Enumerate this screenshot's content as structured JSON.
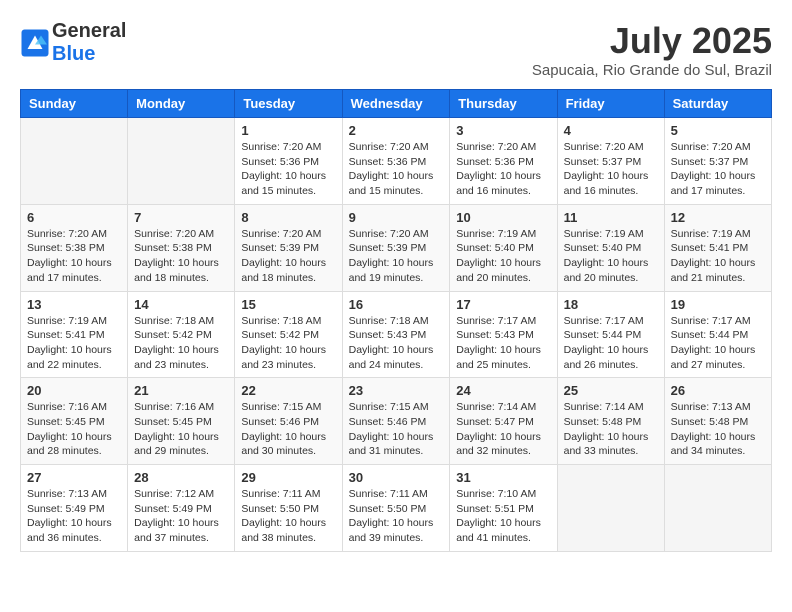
{
  "header": {
    "logo_line1": "General",
    "logo_line2": "Blue",
    "month": "July 2025",
    "location": "Sapucaia, Rio Grande do Sul, Brazil"
  },
  "days_of_week": [
    "Sunday",
    "Monday",
    "Tuesday",
    "Wednesday",
    "Thursday",
    "Friday",
    "Saturday"
  ],
  "weeks": [
    [
      {
        "day": "",
        "info": ""
      },
      {
        "day": "",
        "info": ""
      },
      {
        "day": "1",
        "info": "Sunrise: 7:20 AM\nSunset: 5:36 PM\nDaylight: 10 hours and 15 minutes."
      },
      {
        "day": "2",
        "info": "Sunrise: 7:20 AM\nSunset: 5:36 PM\nDaylight: 10 hours and 15 minutes."
      },
      {
        "day": "3",
        "info": "Sunrise: 7:20 AM\nSunset: 5:36 PM\nDaylight: 10 hours and 16 minutes."
      },
      {
        "day": "4",
        "info": "Sunrise: 7:20 AM\nSunset: 5:37 PM\nDaylight: 10 hours and 16 minutes."
      },
      {
        "day": "5",
        "info": "Sunrise: 7:20 AM\nSunset: 5:37 PM\nDaylight: 10 hours and 17 minutes."
      }
    ],
    [
      {
        "day": "6",
        "info": "Sunrise: 7:20 AM\nSunset: 5:38 PM\nDaylight: 10 hours and 17 minutes."
      },
      {
        "day": "7",
        "info": "Sunrise: 7:20 AM\nSunset: 5:38 PM\nDaylight: 10 hours and 18 minutes."
      },
      {
        "day": "8",
        "info": "Sunrise: 7:20 AM\nSunset: 5:39 PM\nDaylight: 10 hours and 18 minutes."
      },
      {
        "day": "9",
        "info": "Sunrise: 7:20 AM\nSunset: 5:39 PM\nDaylight: 10 hours and 19 minutes."
      },
      {
        "day": "10",
        "info": "Sunrise: 7:19 AM\nSunset: 5:40 PM\nDaylight: 10 hours and 20 minutes."
      },
      {
        "day": "11",
        "info": "Sunrise: 7:19 AM\nSunset: 5:40 PM\nDaylight: 10 hours and 20 minutes."
      },
      {
        "day": "12",
        "info": "Sunrise: 7:19 AM\nSunset: 5:41 PM\nDaylight: 10 hours and 21 minutes."
      }
    ],
    [
      {
        "day": "13",
        "info": "Sunrise: 7:19 AM\nSunset: 5:41 PM\nDaylight: 10 hours and 22 minutes."
      },
      {
        "day": "14",
        "info": "Sunrise: 7:18 AM\nSunset: 5:42 PM\nDaylight: 10 hours and 23 minutes."
      },
      {
        "day": "15",
        "info": "Sunrise: 7:18 AM\nSunset: 5:42 PM\nDaylight: 10 hours and 23 minutes."
      },
      {
        "day": "16",
        "info": "Sunrise: 7:18 AM\nSunset: 5:43 PM\nDaylight: 10 hours and 24 minutes."
      },
      {
        "day": "17",
        "info": "Sunrise: 7:17 AM\nSunset: 5:43 PM\nDaylight: 10 hours and 25 minutes."
      },
      {
        "day": "18",
        "info": "Sunrise: 7:17 AM\nSunset: 5:44 PM\nDaylight: 10 hours and 26 minutes."
      },
      {
        "day": "19",
        "info": "Sunrise: 7:17 AM\nSunset: 5:44 PM\nDaylight: 10 hours and 27 minutes."
      }
    ],
    [
      {
        "day": "20",
        "info": "Sunrise: 7:16 AM\nSunset: 5:45 PM\nDaylight: 10 hours and 28 minutes."
      },
      {
        "day": "21",
        "info": "Sunrise: 7:16 AM\nSunset: 5:45 PM\nDaylight: 10 hours and 29 minutes."
      },
      {
        "day": "22",
        "info": "Sunrise: 7:15 AM\nSunset: 5:46 PM\nDaylight: 10 hours and 30 minutes."
      },
      {
        "day": "23",
        "info": "Sunrise: 7:15 AM\nSunset: 5:46 PM\nDaylight: 10 hours and 31 minutes."
      },
      {
        "day": "24",
        "info": "Sunrise: 7:14 AM\nSunset: 5:47 PM\nDaylight: 10 hours and 32 minutes."
      },
      {
        "day": "25",
        "info": "Sunrise: 7:14 AM\nSunset: 5:48 PM\nDaylight: 10 hours and 33 minutes."
      },
      {
        "day": "26",
        "info": "Sunrise: 7:13 AM\nSunset: 5:48 PM\nDaylight: 10 hours and 34 minutes."
      }
    ],
    [
      {
        "day": "27",
        "info": "Sunrise: 7:13 AM\nSunset: 5:49 PM\nDaylight: 10 hours and 36 minutes."
      },
      {
        "day": "28",
        "info": "Sunrise: 7:12 AM\nSunset: 5:49 PM\nDaylight: 10 hours and 37 minutes."
      },
      {
        "day": "29",
        "info": "Sunrise: 7:11 AM\nSunset: 5:50 PM\nDaylight: 10 hours and 38 minutes."
      },
      {
        "day": "30",
        "info": "Sunrise: 7:11 AM\nSunset: 5:50 PM\nDaylight: 10 hours and 39 minutes."
      },
      {
        "day": "31",
        "info": "Sunrise: 7:10 AM\nSunset: 5:51 PM\nDaylight: 10 hours and 41 minutes."
      },
      {
        "day": "",
        "info": ""
      },
      {
        "day": "",
        "info": ""
      }
    ]
  ]
}
